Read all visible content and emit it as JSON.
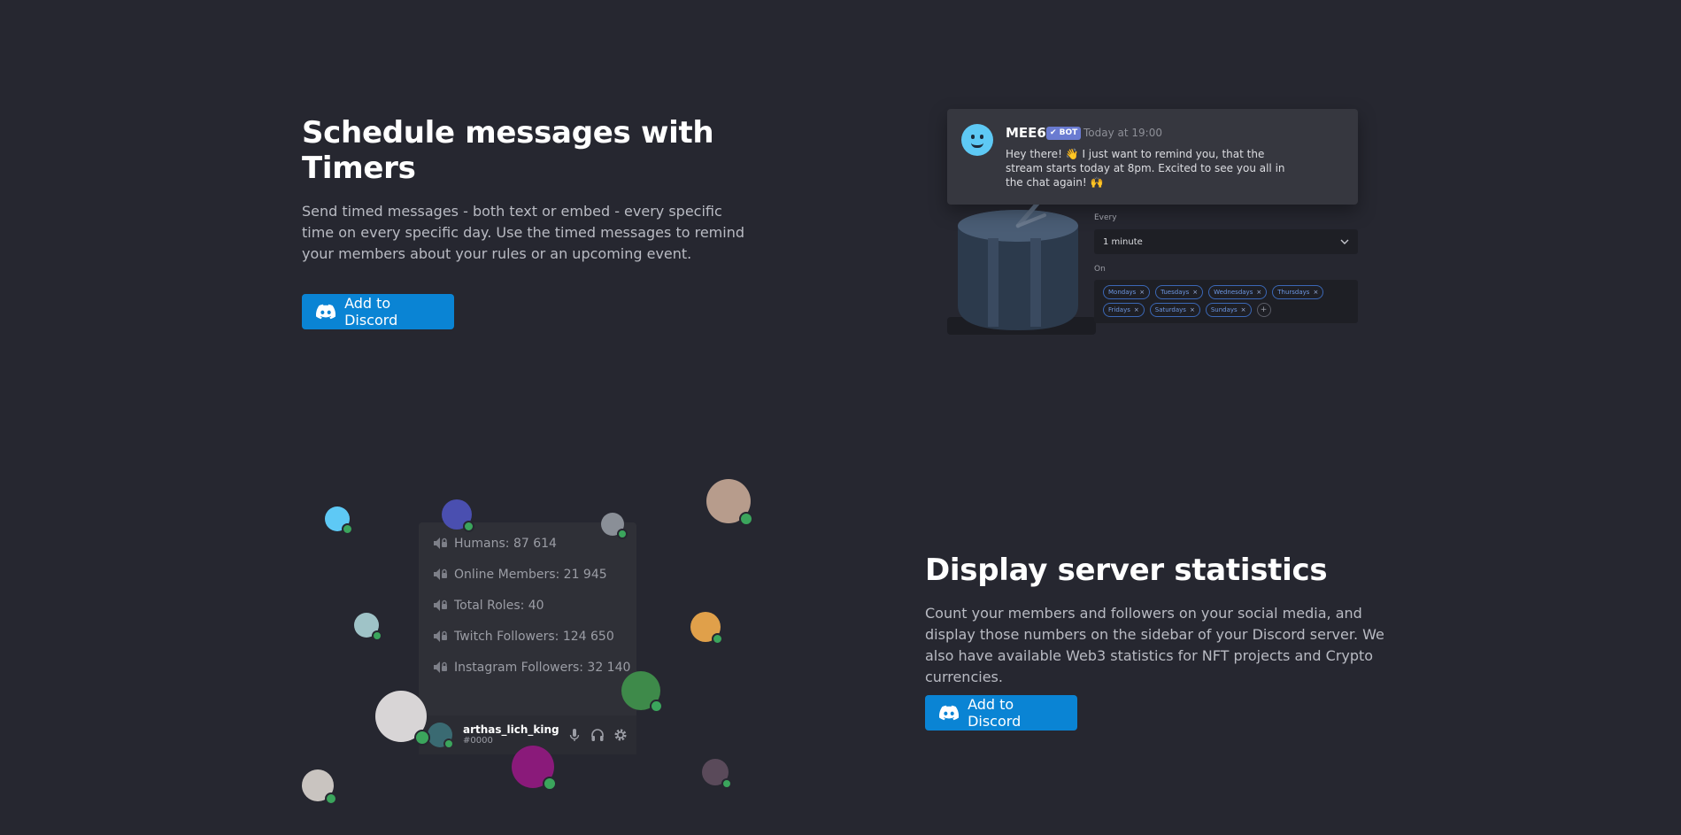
{
  "timers": {
    "title": "Schedule messages with Timers",
    "description": "Send timed messages - both text or embed - every specific time on every specific day. Use the timed messages to remind your members about your rules or an upcoming event.",
    "cta_label": "Add to Discord",
    "preview": {
      "bot_name": "MEE6",
      "bot_badge": "✔ BOT",
      "timestamp": "Today at 19:00",
      "message": "Hey there! 👋 I just want to remind you, that the stream starts today at 8pm. Excited to see you all in the chat again! 🙌",
      "every_label": "Every",
      "every_value": "1 minute",
      "on_label": "On",
      "days": [
        "Mondays",
        "Tuesdays",
        "Wednesdays",
        "Thursdays",
        "Fridays",
        "Saturdays",
        "Sundays"
      ],
      "add_symbol": "+"
    }
  },
  "stats": {
    "title": "Display server statistics",
    "description": "Count your members and followers on your social media, and display those numbers on the sidebar of your Discord server. We also have available Web3 statistics for NFT projects and Crypto currencies.",
    "cta_label": "Add to Discord",
    "channels": [
      "Humans: 87 614",
      "Online Members: 21 945",
      "Total Roles: 40",
      "Twitch Followers: 124 650",
      "Instagram Followers: 32 140"
    ],
    "user": {
      "name": "arthas_lich_king",
      "tag": "#0000"
    }
  },
  "colors": {
    "background": "#262730",
    "accent": "#0a84d4",
    "online": "#3ba55c",
    "bot_badge": "#6a7bd1"
  }
}
